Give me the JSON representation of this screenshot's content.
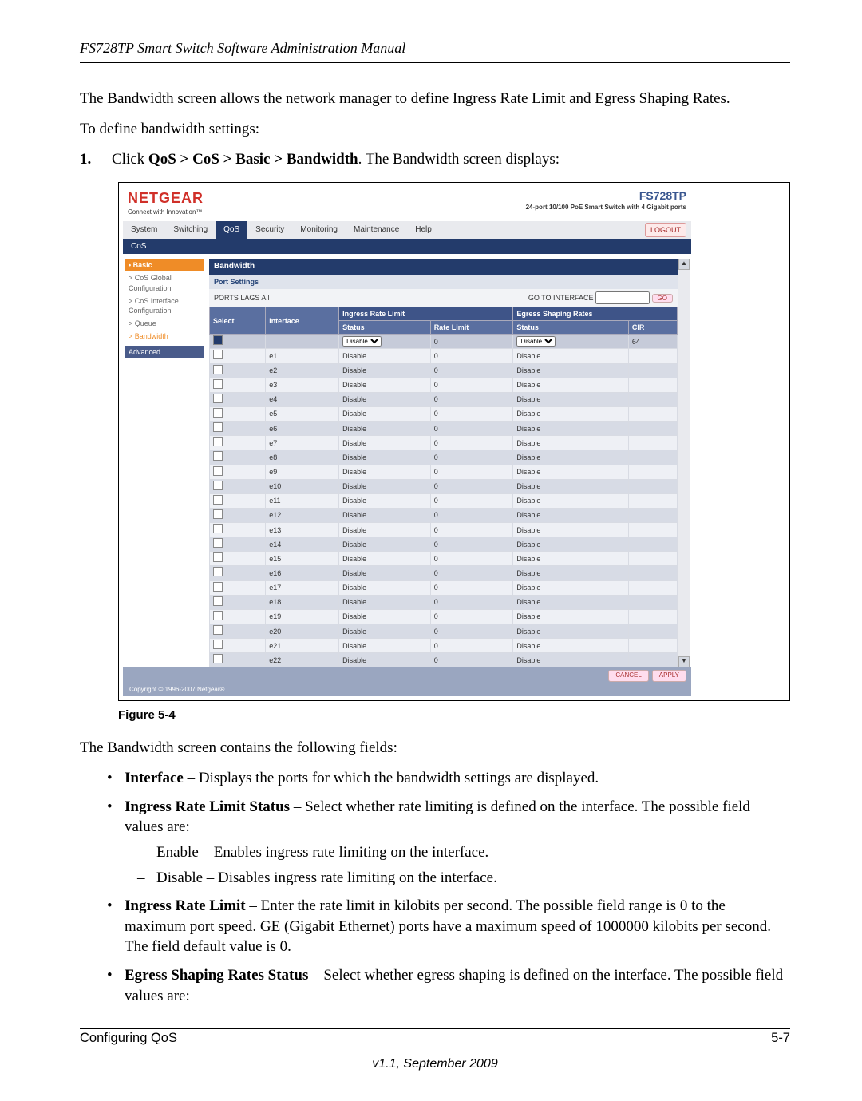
{
  "header": {
    "title": "FS728TP Smart Switch Software Administration Manual"
  },
  "intro": {
    "p1": "The Bandwidth screen allows the network manager to define Ingress Rate Limit and Egress Shaping Rates.",
    "p2": "To define bandwidth settings:"
  },
  "step1": {
    "num": "1.",
    "pre": "Click ",
    "path": "QoS > CoS > Basic > Bandwidth",
    "post": ". The Bandwidth screen displays:"
  },
  "figure": {
    "caption": "Figure 5-4"
  },
  "fields_intro": "The Bandwidth screen contains the following fields:",
  "fields": {
    "f1_label": "Interface",
    "f1_text": " – Displays the ports for which the bandwidth settings are displayed.",
    "f2_label": "Ingress Rate Limit Status",
    "f2_text": " – Select whether rate limiting is defined on the interface. The possible field values are:",
    "f2_sub1": "Enable – Enables ingress rate limiting on the interface.",
    "f2_sub2": "Disable – Disables ingress rate limiting on the interface.",
    "f3_label": "Ingress Rate Limit",
    "f3_text": " – Enter the rate limit in kilobits per second. The possible field range is 0 to the maximum port speed. GE (Gigabit Ethernet) ports have a maximum speed of 1000000 kilobits per second. The field default value is 0.",
    "f4_label": "Egress Shaping Rates Status",
    "f4_text": " – Select whether egress shaping is defined on the interface. The possible field values are:"
  },
  "footer": {
    "left": "Configuring QoS",
    "right": "5-7",
    "version": "v1.1, September 2009"
  },
  "shot": {
    "brand": "NETGEAR",
    "tagline": "Connect with Innovation™",
    "model": "FS728TP",
    "model_sub": "24-port 10/100 PoE\nSmart Switch with 4 Gigabit ports",
    "tabs": [
      "System",
      "Switching",
      "QoS",
      "Security",
      "Monitoring",
      "Maintenance",
      "Help"
    ],
    "tab_active": "QoS",
    "logout": "LOGOUT",
    "subtab": "CoS",
    "sidebar": {
      "group": "• Basic",
      "items": [
        "> CoS Global Configuration",
        "> CoS Interface Configuration",
        "> Queue",
        "> Bandwidth"
      ],
      "selected_index": 3,
      "advanced": "Advanced"
    },
    "panel_title": "Bandwidth",
    "port_settings": "Port Settings",
    "ports_label": "PORTS LAGS All",
    "go_label": "GO TO INTERFACE",
    "go_btn": "GO",
    "headers": {
      "select": "Select",
      "interface": "Interface",
      "ingress_group": "Ingress Rate Limit",
      "egress_group": "Egress Shaping Rates",
      "status": "Status",
      "rate": "Rate Limit",
      "status2": "Status",
      "cir": "CIR"
    },
    "default_status": "Disable",
    "hdr_rate_default": "0",
    "hdr_cir_default": "64",
    "rows": [
      {
        "if": "e1"
      },
      {
        "if": "e2"
      },
      {
        "if": "e3"
      },
      {
        "if": "e4"
      },
      {
        "if": "e5"
      },
      {
        "if": "e6"
      },
      {
        "if": "e7"
      },
      {
        "if": "e8"
      },
      {
        "if": "e9"
      },
      {
        "if": "e10"
      },
      {
        "if": "e11"
      },
      {
        "if": "e12"
      },
      {
        "if": "e13"
      },
      {
        "if": "e14"
      },
      {
        "if": "e15"
      },
      {
        "if": "e16"
      },
      {
        "if": "e17"
      },
      {
        "if": "e18"
      },
      {
        "if": "e19"
      },
      {
        "if": "e20"
      },
      {
        "if": "e21"
      },
      {
        "if": "e22"
      }
    ],
    "cancel": "CANCEL",
    "apply": "APPLY",
    "copyright": "Copyright © 1996-2007 Netgear®"
  }
}
